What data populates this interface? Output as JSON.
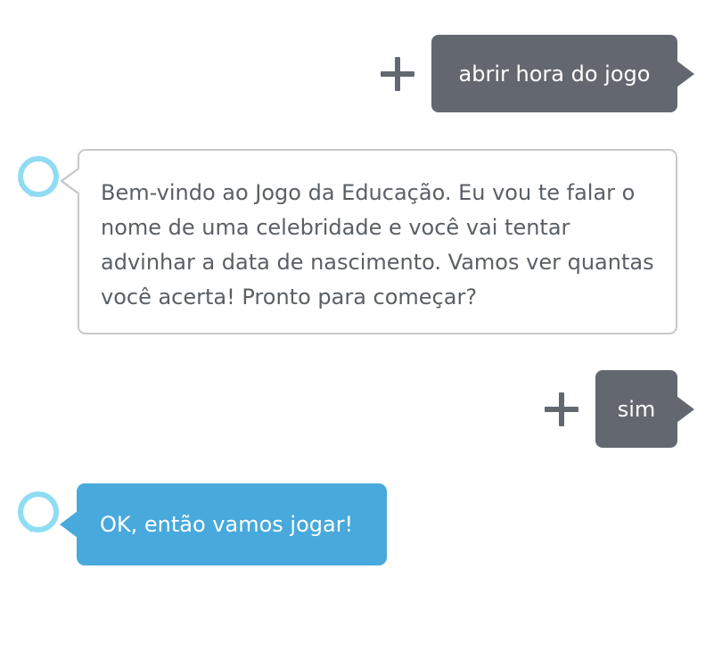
{
  "conversation": {
    "messages": [
      {
        "speaker": "user",
        "text": "abrir hora do jogo",
        "icon": "plus-icon"
      },
      {
        "speaker": "alexa",
        "text": "Bem-vindo ao Jogo da Educação. Eu vou te falar o nome de uma celebridade e você vai tentar advinhar a data de nascimento. Vamos ver quantas você acerta! Pronto para começar?",
        "icon": "alexa-ring-icon",
        "style": "outline"
      },
      {
        "speaker": "user",
        "text": "sim",
        "icon": "plus-icon"
      },
      {
        "speaker": "alexa",
        "text": "OK, então vamos jogar!",
        "icon": "alexa-ring-icon",
        "style": "filled"
      }
    ]
  },
  "colors": {
    "user_bubble": "#636870",
    "alexa_filled_bubble": "#48a9dc",
    "alexa_outline_border": "#c6c9cc",
    "alexa_icon_ring": "#8fdcf3",
    "alexa_text": "#5a5f66"
  }
}
